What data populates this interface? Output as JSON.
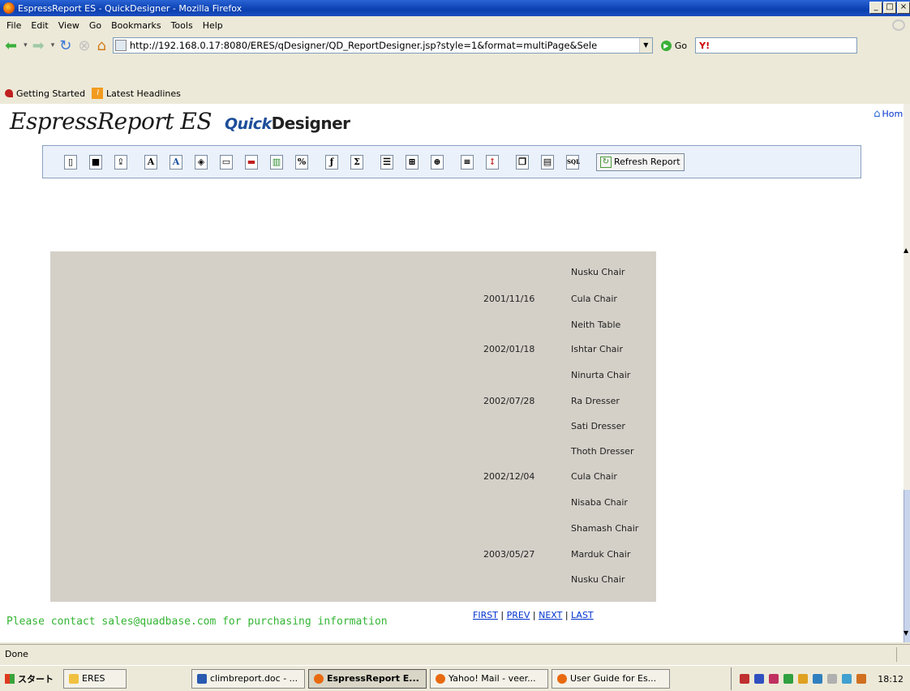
{
  "window": {
    "title": "EspressReport ES - QuickDesigner - Mozilla Firefox",
    "controls": [
      "_",
      "□",
      "×"
    ]
  },
  "menu": [
    "File",
    "Edit",
    "View",
    "Go",
    "Bookmarks",
    "Tools",
    "Help"
  ],
  "nav": {
    "url": "http://192.168.0.17:8080/ERES/qDesigner/QD_ReportDesigner.jsp?style=1&format=multiPage&Sele",
    "go_label": "Go",
    "search_logo": "Y!"
  },
  "bookmarks": [
    "Getting Started",
    "Latest Headlines"
  ],
  "app": {
    "logo_main": "EspressReport ES",
    "logo_quick": "Quick",
    "logo_designer": "Designer",
    "home_label": "Home",
    "refresh_label": "Refresh Report",
    "toolbar_icons": [
      "new-icon",
      "save-icon",
      "export-icon",
      "font-icon",
      "font-color-icon",
      "fill-color-icon",
      "border-icon",
      "line-color-icon",
      "chart-icon",
      "format-icon",
      "formula-icon",
      "summary-icon",
      "insert-row-icon",
      "insert-column-icon",
      "merge-icon",
      "align-icon",
      "sort-icon",
      "copy-icon",
      "paste-icon",
      "sql-icon"
    ]
  },
  "report_rows": [
    {
      "date": "",
      "product": "Nusku Chair"
    },
    {
      "date": "2001/11/16",
      "product": "Cula Chair"
    },
    {
      "date": "",
      "product": "Neith Table"
    },
    {
      "date": "2002/01/18",
      "product": "Ishtar Chair"
    },
    {
      "date": "",
      "product": "Ninurta Chair"
    },
    {
      "date": "2002/07/28",
      "product": "Ra Dresser"
    },
    {
      "date": "",
      "product": "Sati Dresser"
    },
    {
      "date": "",
      "product": "Thoth Dresser"
    },
    {
      "date": "2002/12/04",
      "product": "Cula Chair"
    },
    {
      "date": "",
      "product": "Nisaba Chair"
    },
    {
      "date": "",
      "product": "Shamash Chair"
    },
    {
      "date": "2003/05/27",
      "product": "Marduk Chair"
    },
    {
      "date": "",
      "product": "Nusku Chair"
    }
  ],
  "footer": {
    "contact": "Please contact sales@quadbase.com for purchasing information",
    "first": "FIRST",
    "prev": "PREV",
    "next": "NEXT",
    "last": "LAST",
    "sep": " | "
  },
  "status": "Done",
  "taskbar": {
    "start": "スタート",
    "items": [
      "ERES",
      "climbreport.doc - ...",
      "EspressReport E...",
      "Yahoo! Mail - veer...",
      "User Guide for Es..."
    ],
    "active_index": 2,
    "clock": "18:12"
  }
}
